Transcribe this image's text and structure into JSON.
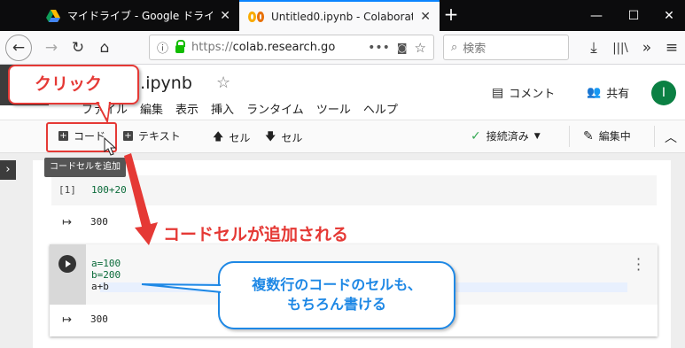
{
  "browser": {
    "tabs": [
      {
        "label": "マイドライブ - Google ドライブ",
        "icon": "google-drive-icon"
      },
      {
        "label": "Untitled0.ipynb - Colaboratory",
        "icon": "colab-icon"
      }
    ],
    "url": {
      "prefix": "https://",
      "host": "colab.research.go"
    },
    "search_placeholder": "検索"
  },
  "colab": {
    "notebook_title": "d0.ipynb",
    "comment_label": "コメント",
    "share_label": "共有",
    "avatar_initial": "I",
    "menu": [
      "ファイル",
      "編集",
      "表示",
      "挿入",
      "ランタイム",
      "ツール",
      "ヘルプ"
    ],
    "toolbar": {
      "code": "コード",
      "text": "テキスト",
      "cell_up": "セル",
      "cell_down": "セル",
      "connected": "接続済み",
      "editing": "編集中"
    },
    "tooltip": "コードセルを追加"
  },
  "cells": [
    {
      "exec": "[1]",
      "code": "100+20",
      "output": "300"
    },
    {
      "code_lines": [
        "a=100",
        "b=200",
        "a+b"
      ],
      "output": "300"
    }
  ],
  "annotations": {
    "click": "クリック",
    "added": "コードセルが追加される",
    "note_line1": "複数行のコードのセルも、",
    "note_line2": "もちろん書ける"
  },
  "colors": {
    "accent_red": "#e53935",
    "accent_blue": "#1e88e5",
    "connected_green": "#34a853"
  }
}
